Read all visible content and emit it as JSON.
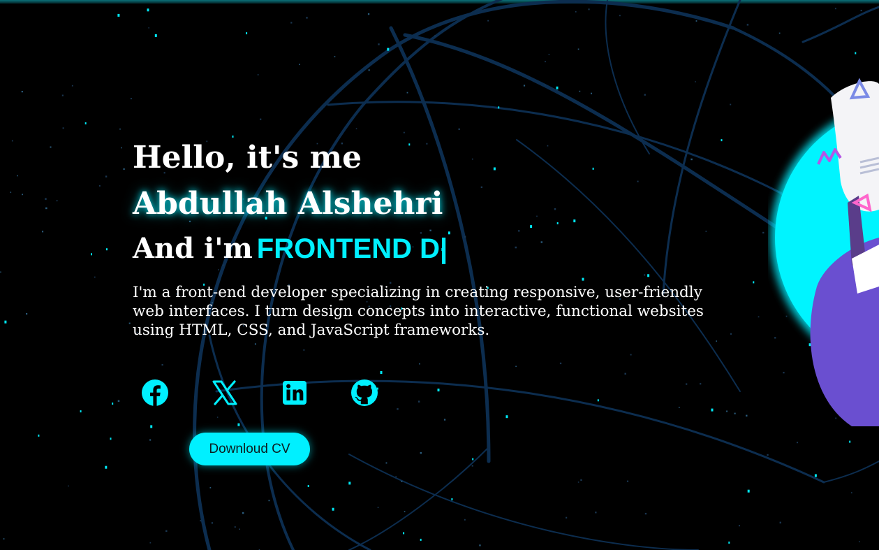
{
  "hero": {
    "greeting": "Hello, it's me",
    "name": "Abdullah Alshehri",
    "role_prefix": "And i'm",
    "role_typed": "FRONTEND D|",
    "intro": "I'm a front-end developer specializing in creating responsive, user-friendly web interfaces. I turn design concepts into interactive, functional websites using HTML, CSS, and JavaScript frameworks."
  },
  "socials": [
    {
      "name": "Facebook",
      "icon": "facebook-icon"
    },
    {
      "name": "X",
      "icon": "x-twitter-icon"
    },
    {
      "name": "LinkedIn",
      "icon": "linkedin-icon"
    },
    {
      "name": "GitHub",
      "icon": "github-icon"
    }
  ],
  "cv_button": {
    "label": "Downloud CV"
  },
  "colors": {
    "accent": "#00f0ff",
    "background": "#000000",
    "text": "#ffffff",
    "globe_lines": "#0b2a4a",
    "avatar_purple": "#6a4fd0"
  }
}
